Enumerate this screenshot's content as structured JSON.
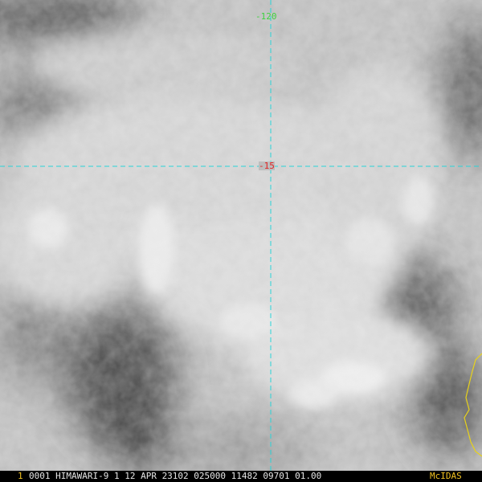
{
  "image": {
    "description": "Himawari-9 satellite imagery of a tropical cyclone over Western Australia region",
    "lon_label": "-120",
    "lat_label": "-15"
  },
  "status": {
    "frame_no": "1",
    "text": "0001 HIMAWARI-9  1 12 APR 23102 025000 11482 09701 01.00",
    "brand": "McIDAS"
  },
  "colors": {
    "grid": "#29d4d8",
    "lon_text": "#3fd23f",
    "lat_text": "#e02424",
    "status_text": "#e6e6e6",
    "frame_no": "#f0c020",
    "coast": "#e8d21a"
  }
}
